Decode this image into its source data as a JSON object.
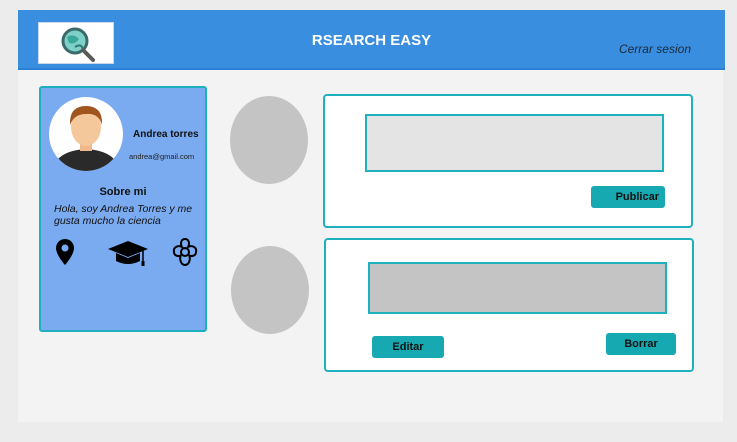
{
  "header": {
    "logo_icon": "search-globe-icon",
    "title": "RSEARCH EASY",
    "logout_label": "Cerrar sesion"
  },
  "profile": {
    "name": "Andrea torres",
    "email": "andrea@gmail.com",
    "about_title": "Sobre mi",
    "about_text": "Hola, soy Andrea Torres y me gusta mucho la ciencia",
    "icons": [
      "location-icon",
      "graduation-cap-icon",
      "flower-icon"
    ]
  },
  "new_post": {
    "text_value": "",
    "publish_label": "Publicar"
  },
  "existing_post": {
    "text_value": "",
    "edit_label": "Editar",
    "delete_label": "Borrar"
  },
  "colors": {
    "header": "#3a8ee0",
    "card": "#7aaaf0",
    "accent": "#1fb0c0",
    "button": "#17a9b1"
  }
}
